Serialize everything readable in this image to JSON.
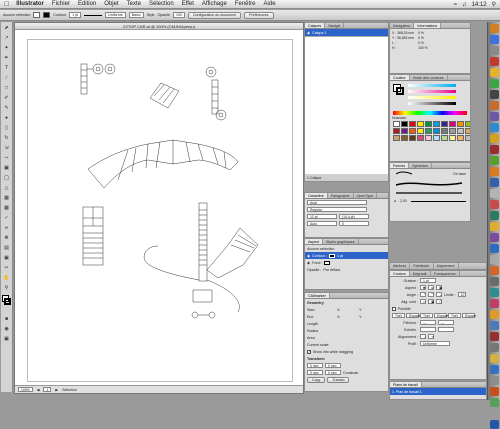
{
  "menubar": {
    "app": "Illustrator",
    "items": [
      "Fichier",
      "Edition",
      "Objet",
      "Texte",
      "Sélection",
      "Effet",
      "Affichage",
      "Fenêtre",
      "Aide"
    ],
    "time": "14:12"
  },
  "control": {
    "selection": "Aucune sélection",
    "stroke_label": "Contour",
    "stroke_weight": "1 pt",
    "uniform": "Uniforme",
    "brush": "Basic",
    "style": "Style",
    "opacity_label": "Opacité",
    "opacity": "100",
    "doc_settings": "Configuration du document",
    "prefs": "Préférences"
  },
  "document": {
    "title": "ZZTOP CAR.ai @ 100% (CMJN/Aperçu)",
    "zoom": "100%",
    "page": "1",
    "status": "Sélection"
  },
  "panels": {
    "layers": {
      "tab1": "Calques",
      "tab2": "Navigat",
      "layer_name": "Calque 1",
      "footer": "1 Calque"
    },
    "navigator": {
      "tab1": "Navigateur",
      "tab2": "Informations",
      "x": "X : 368,25 mm",
      "y": "Y : 36,653 mm",
      "w": "L :",
      "h": "H :",
      "pct1": "0 %",
      "pct2": "0 %",
      "pct3": "0 %",
      "pct4": "100 %"
    },
    "color": {
      "tab1": "Couleur",
      "tab2": "Guide des couleurs",
      "label": "Nuancier"
    },
    "brushes": {
      "tab1": "Formes",
      "tab2": "Symboles",
      "item1": "De base",
      "item2": "2,00"
    },
    "character": {
      "tab1": "Caractère",
      "tab2": "Paragraphe",
      "tab3": "OpenType",
      "font": "Arial",
      "style": "Regular",
      "size": "12 pt",
      "leading": "(14,4 pt)",
      "tracking": "Auto",
      "kerning": "0"
    },
    "appearance": {
      "tab1": "Aspect",
      "tab2": "Styles graphiques",
      "nosel": "Aucune sélection",
      "stroke": "Contour :",
      "stroke_val": "1 pt",
      "fill": "Fond :",
      "opacity": "Opacité :",
      "opacity_val": "Par défaut"
    },
    "attributes": {
      "tab1": "Attributs",
      "tab2": "Pathfinder",
      "tab3": "Alignement"
    },
    "stroke": {
      "tab1": "Contour",
      "tab2": "Dégradé",
      "tab3": "Transparence",
      "weight": "Graisse :",
      "weight_val": "1 pt",
      "cap": "Aspect :",
      "corner": "Angle :",
      "limit": "Limite :",
      "limit_val": "10",
      "align": "Alig. cont :",
      "dashed": "Pointillé",
      "dash_labels": [
        "Tiret",
        "Espace",
        "Tiret",
        "Espace",
        "Tiret",
        "Espace"
      ],
      "arrows": "Flèches :",
      "scale": "Echelle :",
      "align2": "Alignement :",
      "profile": "Profil :",
      "profile_val": "Uniforme"
    },
    "info": {
      "title": "CAllmarker",
      "geometry": "Geometry",
      "labels": [
        "Start",
        "End",
        "Length",
        "Radius",
        "Area"
      ],
      "sx": "X:",
      "sy": "Y:",
      "current_scale": "Current scale:",
      "show_info": "Show info while dragging",
      "transform": "Transform",
      "mm1": "0 mm",
      "mm2": "0 mm",
      "mm3": "0 mm",
      "mm4": "0 mm",
      "constrain": "Constrain",
      "btn1": "Copy",
      "btn2": "Transfo"
    },
    "artboards": {
      "title": "Plans de travail",
      "item": "Plan de travail 1"
    }
  },
  "swatch_colors": [
    "#ffffff",
    "#000000",
    "#e30613",
    "#ffed00",
    "#009640",
    "#00a0e3",
    "#312783",
    "#e6007e",
    "#f39200",
    "#95c11f",
    "#a61e22",
    "#6f1f7b",
    "#ea5d0e",
    "#fcea10",
    "#2a9c5f",
    "#0091d6",
    "#7a7a7a",
    "#9c9c9c",
    "#c2c2c2",
    "#e0a85a",
    "#c7a26b",
    "#8b5a2b",
    "#5f3b1c",
    "#d24b7a",
    "#f7c6d9",
    "#b5e3f5",
    "#b7d98c",
    "#fdf09b",
    "#f5b06b",
    "#c0c0c0"
  ],
  "dock_colors": [
    "#d08020",
    "#3d72d8",
    "#8a8a8a",
    "#c23a2e",
    "#e6b229",
    "#3da545",
    "#444444",
    "#c96b2a",
    "#7057a6",
    "#2f8bd0",
    "#d4a020",
    "#9a2d2d",
    "#5b9e30",
    "#d87b1e",
    "#355fa8",
    "#b4b4b4",
    "#c74b4b",
    "#2c7a60",
    "#e1ad2f",
    "#7b4b9c",
    "#2a6cbf",
    "#a8a8a8",
    "#d4662a",
    "#6b6b6b",
    "#2e8e8e",
    "#bf3f68",
    "#e09a28",
    "#4d79b8",
    "#963030",
    "#777777",
    "#d4b040",
    "#3870c0",
    "#8c8c8c",
    "#c45020",
    "#5aa05a",
    "#9b9b9b",
    "#2658a8"
  ]
}
